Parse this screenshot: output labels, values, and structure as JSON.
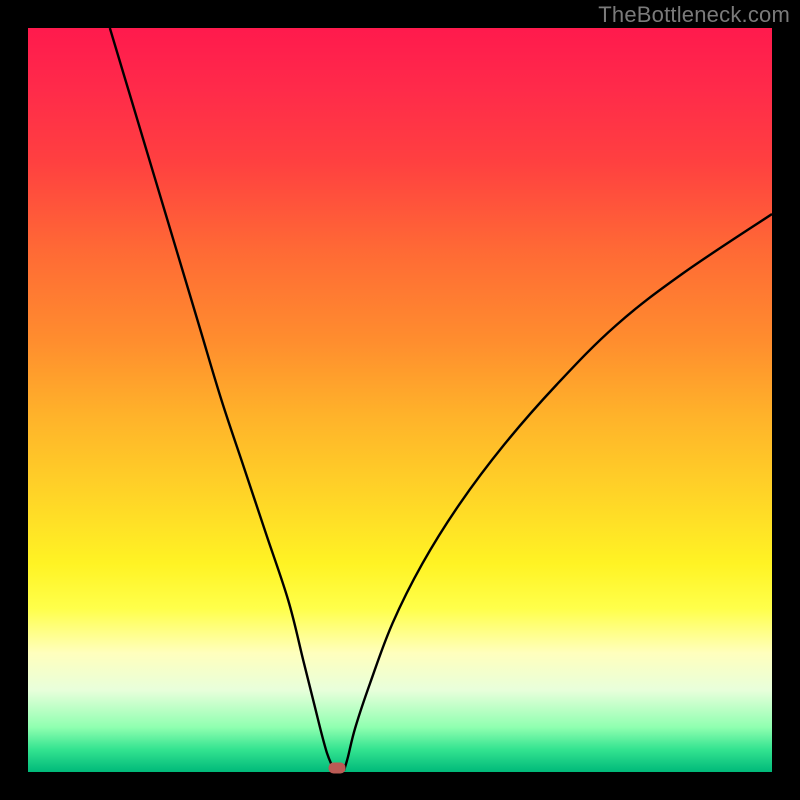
{
  "watermark": "TheBottleneck.com",
  "colors": {
    "curve_stroke": "#000000",
    "marker_fill": "#bb5b55"
  },
  "chart_data": {
    "type": "line",
    "title": "",
    "xlabel": "",
    "ylabel": "",
    "xlim": [
      0,
      100
    ],
    "ylim": [
      0,
      100
    ],
    "grid": false,
    "legend": false,
    "annotations": [
      {
        "kind": "marker",
        "x": 41.5,
        "y": 0.5
      }
    ],
    "series": [
      {
        "name": "left-branch",
        "x": [
          11,
          14,
          17,
          20,
          23,
          26,
          29,
          32,
          35,
          37,
          38.5,
          39.5,
          40.2,
          40.8,
          41.2
        ],
        "y": [
          100,
          90,
          80,
          70,
          60,
          50,
          41,
          32,
          23,
          15,
          9,
          5,
          2.5,
          1,
          0.3
        ]
      },
      {
        "name": "right-branch",
        "x": [
          42.5,
          43,
          44,
          46,
          49,
          53,
          58,
          64,
          71,
          79,
          88,
          100
        ],
        "y": [
          0.3,
          2,
          6,
          12,
          20,
          28,
          36,
          44,
          52,
          60,
          67,
          75
        ]
      }
    ],
    "plateau": {
      "x_start": 40.2,
      "x_end": 42.5,
      "y": 0.3
    }
  }
}
